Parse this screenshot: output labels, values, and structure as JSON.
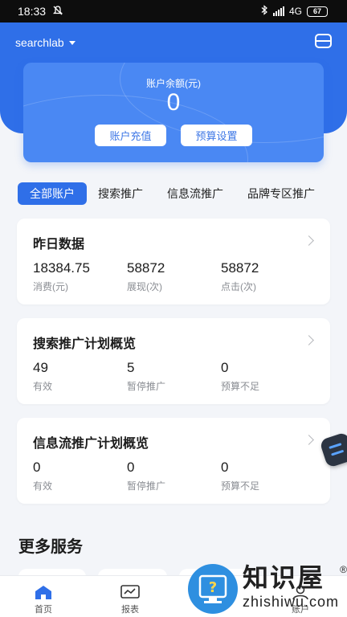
{
  "status_bar": {
    "time": "18:33",
    "network": "4G",
    "battery": "67"
  },
  "header": {
    "account_name": "searchlab"
  },
  "balance": {
    "label": "账户余额(元)",
    "value": "0",
    "recharge_label": "账户充值",
    "budget_label": "预算设置"
  },
  "tabs": [
    {
      "label": "全部账户",
      "active": true
    },
    {
      "label": "搜索推广",
      "active": false
    },
    {
      "label": "信息流推广",
      "active": false
    },
    {
      "label": "品牌专区推广",
      "active": false
    }
  ],
  "yesterday": {
    "title": "昨日数据",
    "metrics": [
      {
        "value": "18384.75",
        "label": "消费(元)"
      },
      {
        "value": "58872",
        "label": "展现(次)"
      },
      {
        "value": "58872",
        "label": "点击(次)"
      }
    ]
  },
  "search_overview": {
    "title": "搜索推广计划概览",
    "metrics": [
      {
        "value": "49",
        "label": "有效"
      },
      {
        "value": "5",
        "label": "暂停推广"
      },
      {
        "value": "0",
        "label": "预算不足"
      }
    ]
  },
  "feed_overview": {
    "title": "信息流推广计划概览",
    "metrics": [
      {
        "value": "0",
        "label": "有效"
      },
      {
        "value": "0",
        "label": "暂停推广"
      },
      {
        "value": "0",
        "label": "预算不足"
      }
    ]
  },
  "more_services": {
    "title": "更多服务"
  },
  "tabbar": [
    {
      "label": "首页",
      "icon": "home-icon",
      "active": true
    },
    {
      "label": "报表",
      "icon": "chart-icon",
      "active": false
    },
    {
      "label": "账户",
      "icon": "account-icon",
      "active": false
    }
  ],
  "watermark": {
    "cn": "知识屋",
    "en": "zhishiwu.com",
    "reg": "®",
    "badge": "?"
  },
  "colors": {
    "primary": "#2f6fe8",
    "card": "#4a88f3",
    "page_bg": "#f3f5f9"
  }
}
